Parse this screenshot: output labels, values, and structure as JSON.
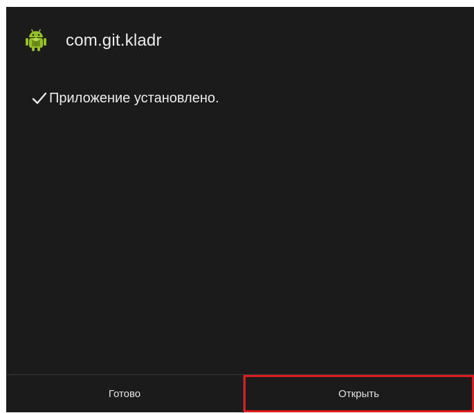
{
  "header": {
    "app_package": "com.git.kladr",
    "icon": "android-robot-icon"
  },
  "status": {
    "icon": "checkmark-icon",
    "message": "Приложение установлено."
  },
  "buttons": {
    "done_label": "Готово",
    "open_label": "Открыть"
  },
  "highlight": {
    "target": "open-button",
    "color": "#e01b1b"
  },
  "colors": {
    "background": "#1b1b1b",
    "text": "#ececec",
    "android_green": "#97c024"
  }
}
